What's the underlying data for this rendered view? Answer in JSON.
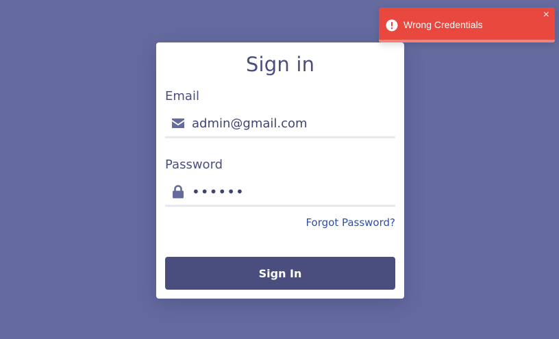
{
  "background_color": "#656b9f",
  "card": {
    "title": "Sign in",
    "email": {
      "label": "Email",
      "value": "admin@gmail.com",
      "icon": "envelope-icon"
    },
    "password": {
      "label": "Password",
      "value": "••••••",
      "icon": "lock-icon"
    },
    "forgot_link": "Forgot Password?",
    "submit_label": "Sign In"
  },
  "toast": {
    "message": "Wrong Credentials",
    "icon": "exclamation-circle-icon",
    "close_glyph": "×",
    "color": "#e8483d",
    "progress": 1.0
  }
}
